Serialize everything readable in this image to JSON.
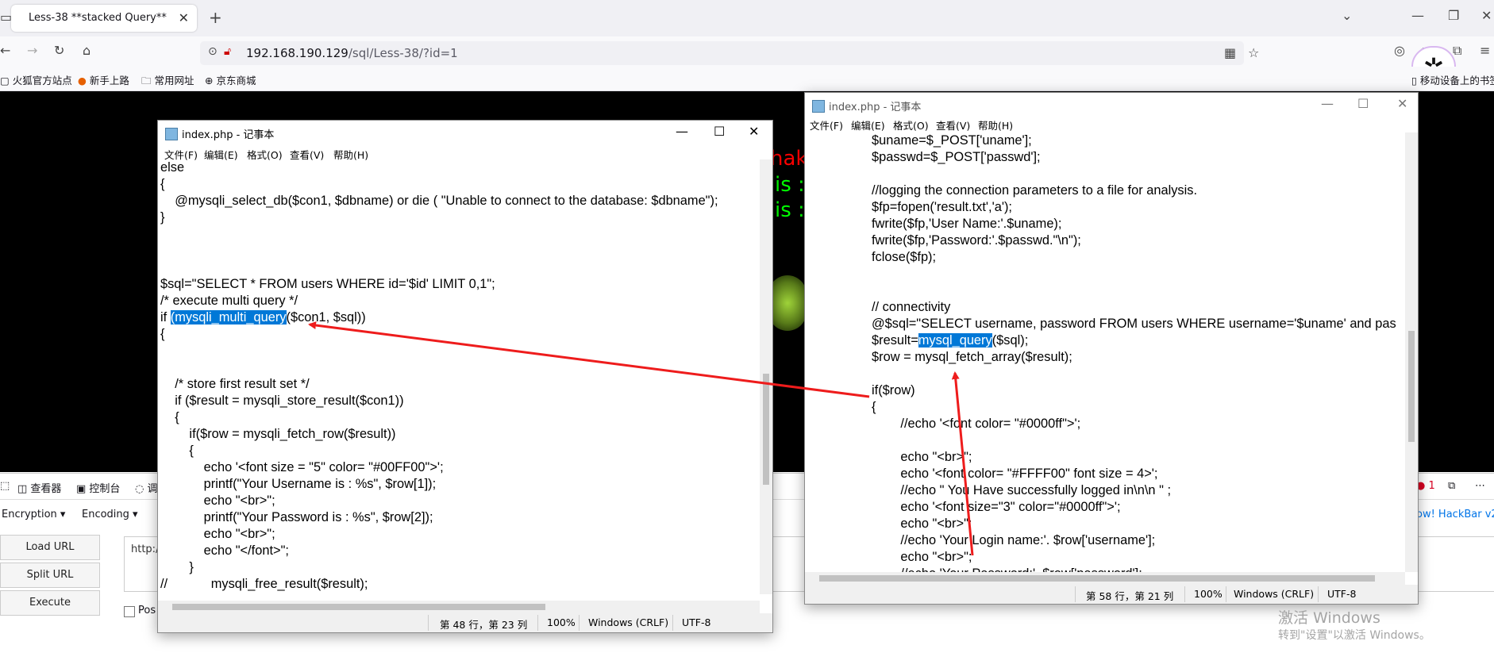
{
  "browser": {
    "tab_title": "Less-38 **stacked Query**",
    "url_host": "192.168.190.129",
    "url_path": "/sql/Less-38/?id=1",
    "bookmarks": [
      "火狐官方站点",
      "新手上路",
      "常用网址",
      "京东商城"
    ],
    "bookmark_right": "移动设备上的书签"
  },
  "page_background": {
    "fragments": [
      "hak",
      "is :",
      "is :"
    ]
  },
  "devtools": {
    "tabs": [
      "查看器",
      "控制台",
      "调"
    ],
    "error_count": "1",
    "hackbar": {
      "encryption_label": "Encryption",
      "encoding_label": "Encoding",
      "load_url": "Load URL",
      "split_url": "Split URL",
      "execute": "Execute",
      "url_value": "http://",
      "post_label": "Pos",
      "brand": "ow! HackBar v2"
    }
  },
  "notepad_left": {
    "title": "index.php - 记事本",
    "menu": [
      "文件(F)",
      "编辑(E)",
      "格式(O)",
      "查看(V)",
      "帮助(H)"
    ],
    "lines": [
      "else",
      "{",
      "    @mysqli_select_db($con1, $dbname) or die ( \"Unable to connect to the database: $dbname\");",
      "}",
      "",
      "",
      "",
      "$sql=\"SELECT * FROM users WHERE id='$id' LIMIT 0,1\";",
      "/* execute multi query */",
      "",
      "{",
      "",
      "",
      "    /* store first result set */",
      "    if ($result = mysqli_store_result($con1))",
      "    {",
      "        if($row = mysqli_fetch_row($result))",
      "        {",
      "            echo '<font size = \"5\" color= \"#00FF00\">';",
      "            printf(\"Your Username is : %s\", $row[1]);",
      "            echo \"<br>\";",
      "            printf(\"Your Password is : %s\", $row[2]);",
      "            echo \"<br>\";",
      "            echo \"</font>\";",
      "        }",
      "//            mysqli_free_result($result);"
    ],
    "line_if_prefix": "if ",
    "line_if_highlight": "(mysqli_multi_query",
    "line_if_suffix": "($con1, $sql))",
    "status_pos": "第 48 行，第 23 列",
    "status_zoom": "100%",
    "status_eol": "Windows (CRLF)",
    "status_enc": "UTF-8"
  },
  "notepad_right": {
    "title": "index.php - 记事本",
    "menu": [
      "文件(F)",
      "编辑(E)",
      "格式(O)",
      "查看(V)",
      "帮助(H)"
    ],
    "lines": [
      "$uname=$_POST['uname'];",
      "$passwd=$_POST['passwd'];",
      "",
      "//logging the connection parameters to a file for analysis.",
      "$fp=fopen('result.txt','a');",
      "fwrite($fp,'User Name:'.$uname);",
      "fwrite($fp,'Password:'.$passwd.\"\\n\");",
      "fclose($fp);",
      "",
      "",
      "// connectivity",
      "@$sql=\"SELECT username, password FROM users WHERE username='$uname' and pas",
      "",
      "$row = mysql_fetch_array($result);",
      "",
      "if($row)",
      "{",
      "        //echo '<font color= \"#0000ff\">';",
      "",
      "        echo \"<br>\";",
      "        echo '<font color= \"#FFFF00\" font size = 4>';",
      "        //echo \" You Have successfully logged in\\n\\n \" ;",
      "        echo '<font size=\"3\" color=\"#0000ff\">';",
      "        echo \"<br>\";",
      "        //echo 'Your Login name:'. $row['username'];",
      "        echo \"<br>\";",
      "        //echo 'Your Password:' .$row['password'];"
    ],
    "line_result_prefix": "$result=",
    "line_result_highlight": "mysql_query",
    "line_result_suffix": "($sql);",
    "status_pos": "第 58 行，第 21 列",
    "status_zoom": "100%",
    "status_eol": "Windows (CRLF)",
    "status_enc": "UTF-8"
  },
  "watermark": {
    "line1": "激活 Windows",
    "line2": "转到\"设置\"以激活 Windows。"
  },
  "colors": {
    "highlight": "#0078d7",
    "arrow": "#ee1c1c",
    "page_bg": "#000000",
    "green_text": "#00ff00",
    "red_text": "#ff0000"
  }
}
